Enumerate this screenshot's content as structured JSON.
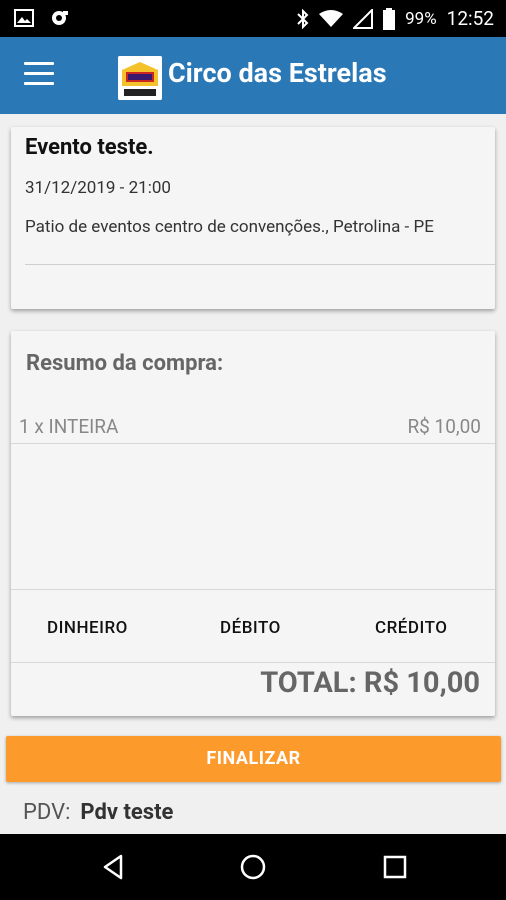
{
  "status_bar": {
    "battery": "99%",
    "time": "12:52",
    "left_icons": [
      "image-icon",
      "camera-icon"
    ],
    "right_icons": [
      "bluetooth-icon",
      "wifi-icon",
      "signal-icon",
      "battery-icon"
    ]
  },
  "app_bar": {
    "title": "Circo das Estrelas",
    "menu_icon": "menu-icon",
    "logo": "circus-logo"
  },
  "event": {
    "title": "Evento teste.",
    "datetime": "31/12/2019 - 21:00",
    "location": "Patio de eventos centro de convenções., Petrolina - PE"
  },
  "summary": {
    "title": "Resumo da compra:",
    "items": [
      {
        "label": "1 x INTEIRA",
        "price": "R$ 10,00"
      }
    ],
    "payment_methods": [
      "DINHEIRO",
      "DÉBITO",
      "CRÉDITO"
    ],
    "total": "TOTAL: R$ 10,00"
  },
  "finalize_label": "FINALIZAR",
  "pdv": {
    "label": "PDV:",
    "value": "Pdv teste"
  },
  "nav_bar": {
    "icons": [
      "back-icon",
      "home-icon",
      "recents-icon"
    ]
  },
  "colors": {
    "app_bar": "#2b78b6",
    "finalize_button": "#fd9a2c",
    "background": "#f0f0f0"
  }
}
